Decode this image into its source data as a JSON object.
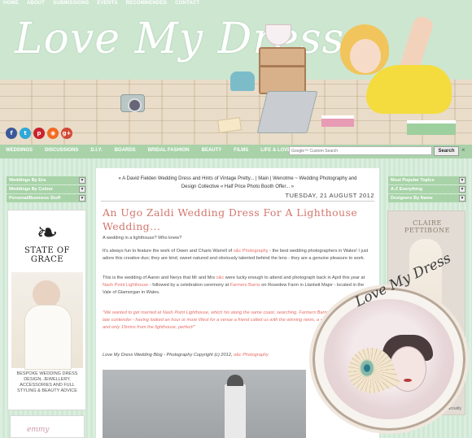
{
  "top_nav": [
    "HOME",
    "ABOUT",
    "SUBMISSIONS",
    "EVENTS",
    "RECOMMENDED",
    "CONTACT"
  ],
  "logo": "Love My Dress",
  "social_icons": [
    {
      "name": "facebook-icon",
      "glyph": "f",
      "color": "#3b5998"
    },
    {
      "name": "twitter-icon",
      "glyph": "t",
      "color": "#2fa8d8"
    },
    {
      "name": "pinterest-icon",
      "glyph": "p",
      "color": "#c8232c"
    },
    {
      "name": "rss-icon",
      "glyph": "◉",
      "color": "#f26b22"
    },
    {
      "name": "google-plus-icon",
      "glyph": "g+",
      "color": "#d34836"
    }
  ],
  "main_nav": [
    "WEDDINGS",
    "DISCUSSIONS",
    "D.I.Y.",
    "BOARDS",
    "BRIDAL FASHION",
    "BEAUTY",
    "FILMS",
    "LIFE & LOVE"
  ],
  "search": {
    "placeholder": "Google™ Custom Search",
    "button": "Search",
    "clear": "×"
  },
  "left_dropdowns": [
    "Weddings By Era",
    "Weddings By Colour",
    "Personal/Business Stuff"
  ],
  "right_dropdowns": [
    "Most Popular Topics",
    "A-Z Everything",
    "Designers By Name"
  ],
  "left_ad": {
    "brand": "STATE OF GRACE",
    "caption": "BESPOKE WEDDING DRESS DESIGN, JEWELLERY, ACCESSORIES AND FULL STYLING & BEAUTY ADVICE"
  },
  "left_ad2": {
    "brand": "emmy"
  },
  "right_ad": {
    "brand": "CLAIRE PETTIBONE",
    "credit": "Groudly"
  },
  "post": {
    "nav": "« A David Fielden Wedding Dress and Hints of Vintage Pretty... | Main | Wenotme ~ Wedding Photography and Design Collective « Half Price Photo Booth Offer... »",
    "date": "TUESDAY, 21 AUGUST 2012",
    "title": "An Ugo Zaldi Wedding Dress For A Lighthouse Wedding...",
    "p1": "A wedding in a lighthouse? Who knew?",
    "p2_a": "It's always fun to feature the work of Owen and Charis Warrell of ",
    "p2_link": "o&c Photography",
    "p2_b": " - the best wedding photographers in Wales! I just adore this creative duo; they are kind, sweet natured and obviously talented behind the lens - they are a genuine pleasure to work.",
    "p3_a": "This is the wedding of Aaron and Nerys that Mr and Mrs ",
    "p3_link1": "o&c",
    "p3_b": " were lucky enough to attend and photograph back in April this year at ",
    "p3_link2": "Nash Point Lighthouse",
    "p3_c": " - followed by a celebration ceremony at ",
    "p3_link3": "Farmers Barns",
    "p3_d": " on Rosedew Farm in Llantwit Major - located in the Vale of Glamorgan in Wales.",
    "quote": "\"We wanted to get married at Nash Point Lighthouse, which his along the same coast, searching. Farmers Barns was a very lucky late contender - having looked an hour or more West for a venue a friend called us with the winning news, a venue, on a farm right and only 15mins from the lighthouse, perfect!\"",
    "credit_a": "Love My Dress Wedding Blog - Photography Copyright (c) 2012, ",
    "credit_link": "o&c Photography"
  },
  "badge": {
    "text": "Love My Dress"
  },
  "colors": {
    "accent_pink": "#e56d66",
    "title_pink": "#d2776e",
    "nav_green": "#a9d2a9",
    "bg_mint": "#cfe8d4"
  }
}
